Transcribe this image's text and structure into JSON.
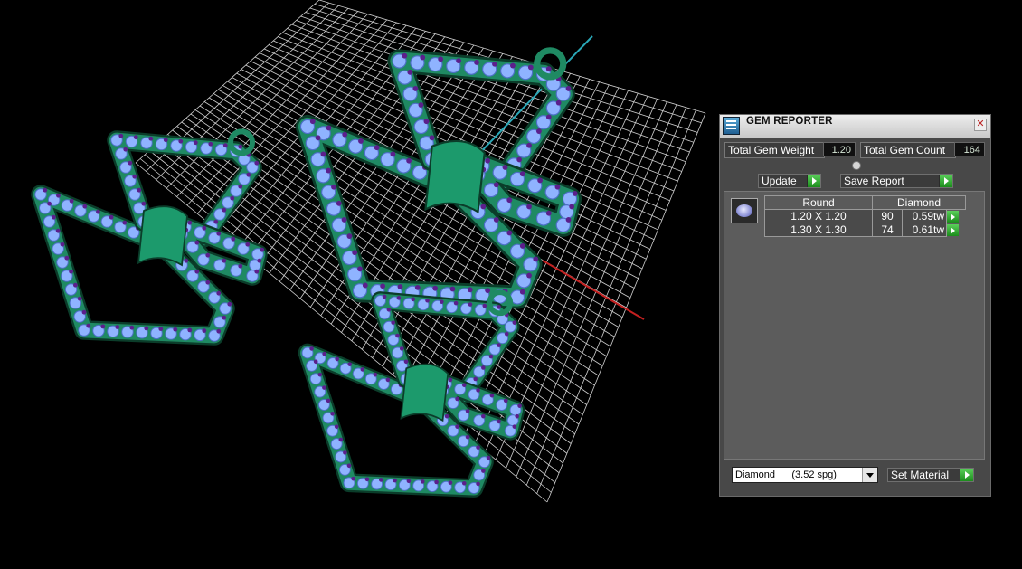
{
  "panel": {
    "title": "GEM REPORTER",
    "icon": "gem-reporter-icon",
    "total_weight_label": "Total Gem Weight",
    "total_weight_value": "1.20",
    "total_count_label": "Total Gem Count",
    "total_count_value": "164",
    "update_label": "Update",
    "save_report_label": "Save Report",
    "table": {
      "col_cut": "Round",
      "col_material": "Diamond",
      "rows": [
        {
          "size": "1.20 X 1.20",
          "count": "90",
          "weight": "0.59tw"
        },
        {
          "size": "1.30 X 1.30",
          "count": "74",
          "weight": "0.61tw"
        }
      ]
    },
    "material_select": "Diamond      (3.52 spg)",
    "set_material_label": "Set Material"
  },
  "colors": {
    "metal": "#1f8a63",
    "gem": "#8fb3ff",
    "prong": "#5b1f8c",
    "grid": "#d8d8d8",
    "axis_y": "#2aa8b8",
    "axis_x": "#c42020"
  }
}
